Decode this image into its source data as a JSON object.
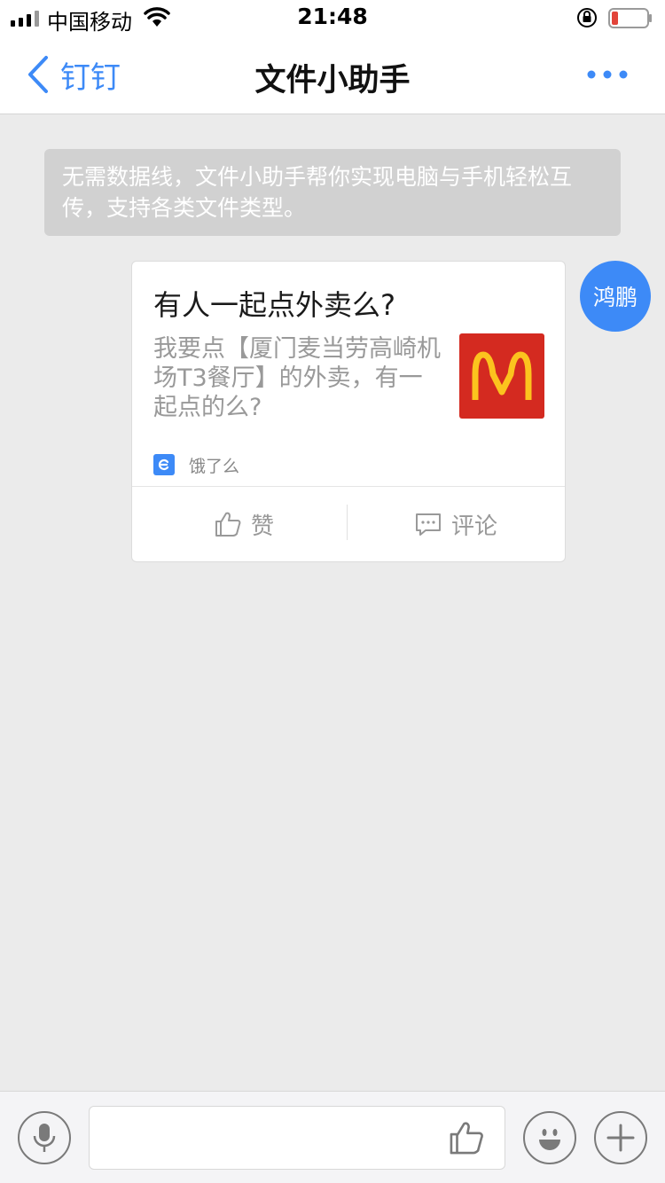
{
  "status_bar": {
    "carrier": "中国移动",
    "time": "21:48",
    "battery_color": "#e2443a"
  },
  "nav": {
    "back_label": "钉钉",
    "title": "文件小助手",
    "accent_color": "#3d8af7"
  },
  "system_tip": {
    "text": "无需数据线，文件小助手帮你实现电脑与手机轻松互传，支持各类文件类型。"
  },
  "message": {
    "avatar_text": "鸿鹏",
    "card": {
      "title": "有人一起点外卖么?",
      "description": "我要点【厦门麦当劳高崎机场T3餐厅】的外卖，有一起点的么?",
      "thumbnail_icon": "mcdonalds-logo",
      "source_label": "饿了么",
      "like_label": "赞",
      "comment_label": "评论"
    }
  },
  "input_bar": {
    "text_value": "",
    "placeholder": ""
  }
}
